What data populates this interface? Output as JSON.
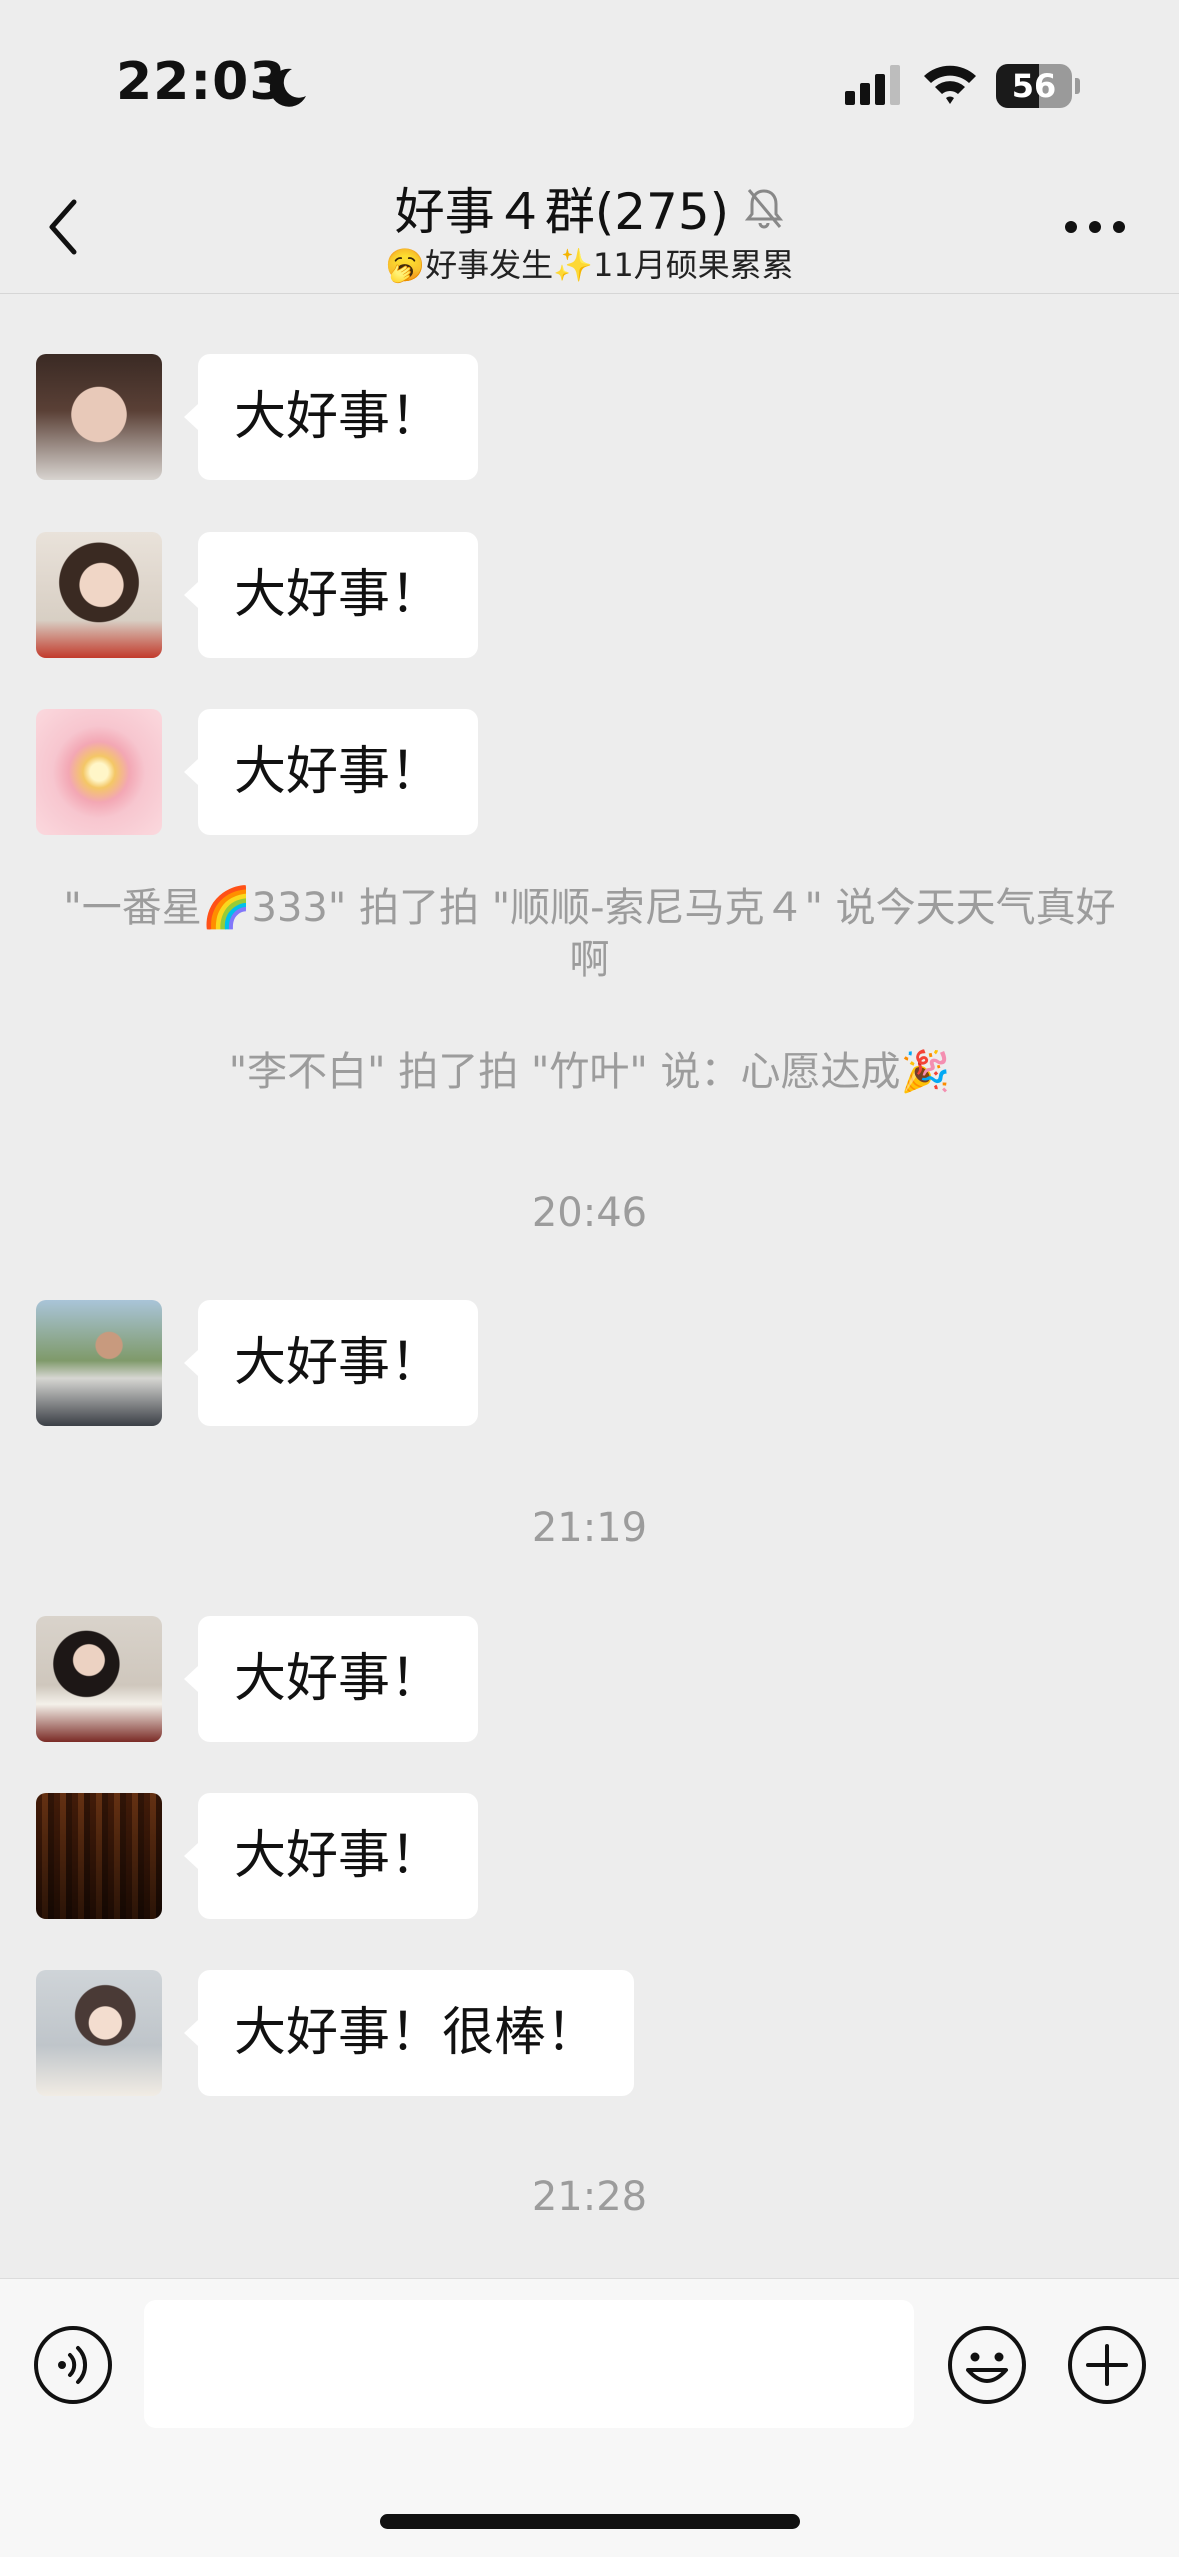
{
  "status_bar": {
    "time": "22:03",
    "battery_level": "56",
    "battery_fraction": 0.56,
    "icons": [
      "moon-icon",
      "cellular-signal-icon",
      "wifi-icon",
      "battery-icon"
    ]
  },
  "header": {
    "title": "好事４群(275)",
    "subtitle": "🥱好事发生✨11月硕果累累",
    "icons": [
      "back-icon",
      "mute-bell-icon",
      "more-icon"
    ]
  },
  "messages": [
    {
      "text": "大好事！",
      "avatar": "woman-portrait-avatar"
    },
    {
      "text": "大好事！",
      "avatar": "anime-girl-avatar"
    },
    {
      "text": "大好事！",
      "avatar": "glowing-orb-avatar"
    },
    {
      "text": "大好事！",
      "avatar": "man-outdoors-avatar"
    },
    {
      "text": "大好事！",
      "avatar": "woman-reading-avatar"
    },
    {
      "text": "大好事！",
      "avatar": "library-room-avatar"
    },
    {
      "text": "大好事！很棒！",
      "avatar": "child-at-desk-avatar"
    }
  ],
  "system_notes": [
    "\"一番星🌈333\" 拍了拍 \"顺顺-索尼马克４\" 说今天天气真好啊",
    "\"李不白\" 拍了拍 \"竹叶\" 说：心愿达成🎉"
  ],
  "timestamps": [
    "20:46",
    "21:19",
    "21:28"
  ],
  "input_bar": {
    "message_value": "",
    "icons": [
      "voice-icon",
      "emoji-icon",
      "plus-icon"
    ]
  },
  "colors": {
    "background": "#ededed",
    "bubble": "#ffffff",
    "system_text": "#9c9c9c",
    "input_bar": "#f7f7f7"
  }
}
